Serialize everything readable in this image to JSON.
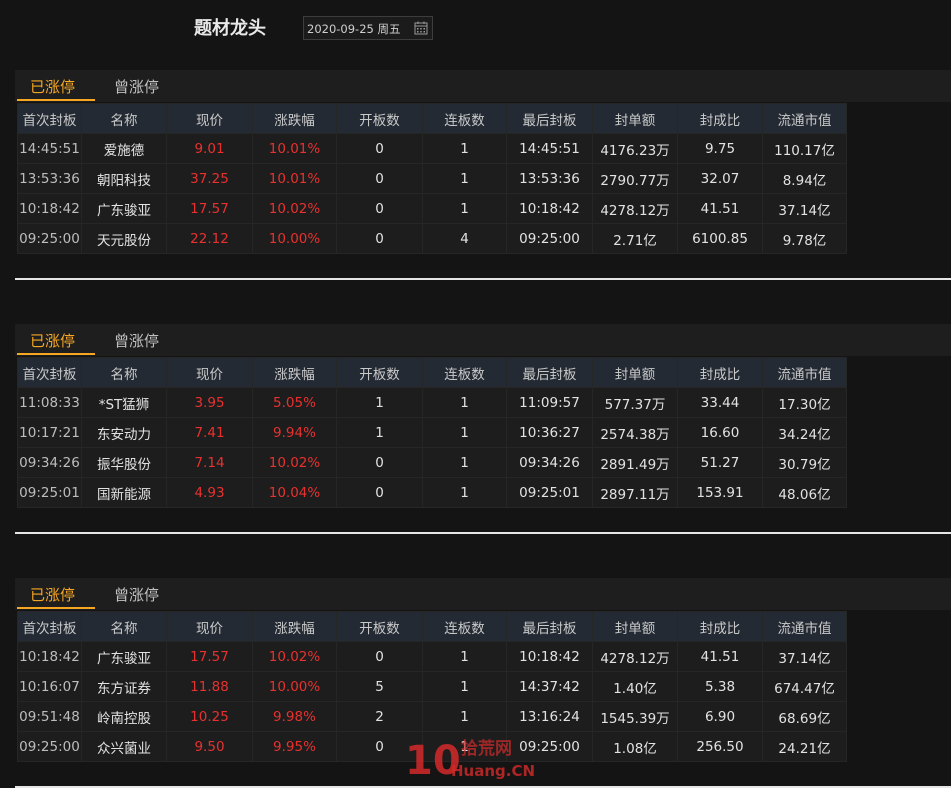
{
  "header": {
    "title": "题材龙头",
    "date_value": "2020-09-25 周五"
  },
  "columns": [
    "首次封板",
    "名称",
    "现价",
    "涨跌幅",
    "开板数",
    "连板数",
    "最后封板",
    "封单额",
    "封成比",
    "流通市值"
  ],
  "panels": [
    {
      "tabs": {
        "active": "已涨停",
        "inactive": "曾涨停"
      },
      "rows": [
        [
          "14:45:51",
          "爱施德",
          "9.01",
          "10.01%",
          "0",
          "1",
          "14:45:51",
          "4176.23万",
          "9.75",
          "110.17亿"
        ],
        [
          "13:53:36",
          "朝阳科技",
          "37.25",
          "10.01%",
          "0",
          "1",
          "13:53:36",
          "2790.77万",
          "32.07",
          "8.94亿"
        ],
        [
          "10:18:42",
          "广东骏亚",
          "17.57",
          "10.02%",
          "0",
          "1",
          "10:18:42",
          "4278.12万",
          "41.51",
          "37.14亿"
        ],
        [
          "09:25:00",
          "天元股份",
          "22.12",
          "10.00%",
          "0",
          "4",
          "09:25:00",
          "2.71亿",
          "6100.85",
          "9.78亿"
        ]
      ]
    },
    {
      "tabs": {
        "active": "已涨停",
        "inactive": "曾涨停"
      },
      "rows": [
        [
          "11:08:33",
          "*ST猛狮",
          "3.95",
          "5.05%",
          "1",
          "1",
          "11:09:57",
          "577.37万",
          "33.44",
          "17.30亿"
        ],
        [
          "10:17:21",
          "东安动力",
          "7.41",
          "9.94%",
          "1",
          "1",
          "10:36:27",
          "2574.38万",
          "16.60",
          "34.24亿"
        ],
        [
          "09:34:26",
          "振华股份",
          "7.14",
          "10.02%",
          "0",
          "1",
          "09:34:26",
          "2891.49万",
          "51.27",
          "30.79亿"
        ],
        [
          "09:25:01",
          "国新能源",
          "4.93",
          "10.04%",
          "0",
          "1",
          "09:25:01",
          "2897.11万",
          "153.91",
          "48.06亿"
        ]
      ]
    },
    {
      "tabs": {
        "active": "已涨停",
        "inactive": "曾涨停"
      },
      "rows": [
        [
          "10:18:42",
          "广东骏亚",
          "17.57",
          "10.02%",
          "0",
          "1",
          "10:18:42",
          "4278.12万",
          "41.51",
          "37.14亿"
        ],
        [
          "10:16:07",
          "东方证券",
          "11.88",
          "10.00%",
          "5",
          "1",
          "14:37:42",
          "1.40亿",
          "5.38",
          "674.47亿"
        ],
        [
          "09:51:48",
          "岭南控股",
          "10.25",
          "9.98%",
          "2",
          "1",
          "13:16:24",
          "1545.39万",
          "6.90",
          "68.69亿"
        ],
        [
          "09:25:00",
          "众兴菌业",
          "9.50",
          "9.95%",
          "0",
          "1",
          "09:25:00",
          "1.08亿",
          "256.50",
          "24.21亿"
        ]
      ]
    }
  ],
  "watermark": {
    "big": "10",
    "line1": "拾荒网",
    "line2": "Huang.CN"
  },
  "colors": {
    "accent": "#f5a623",
    "up_red": "#e8312f",
    "background": "#141414",
    "header_bg": "#232a33"
  },
  "icons": {
    "date_picker": "calendar-icon"
  }
}
